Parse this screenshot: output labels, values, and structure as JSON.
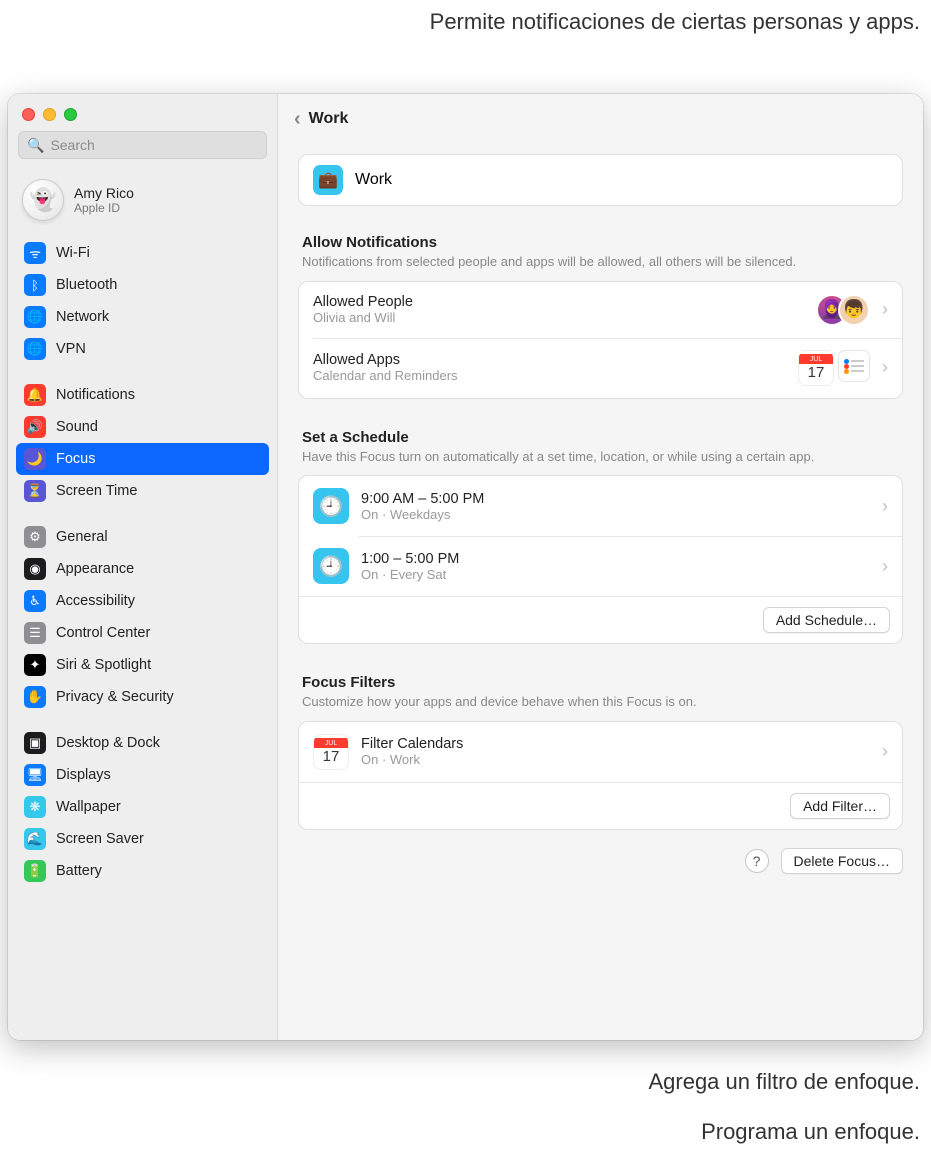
{
  "callouts": {
    "top": "Permite notificaciones de ciertas personas y apps.",
    "filter": "Agrega un filtro de enfoque.",
    "schedule": "Programa un enfoque."
  },
  "search": {
    "placeholder": "Search"
  },
  "user": {
    "name": "Amy Rico",
    "sub": "Apple ID",
    "emoji": "👻"
  },
  "sidebar": [
    {
      "label": "Wi-Fi",
      "color": "#0a7aff",
      "glyph": "ᯤ"
    },
    {
      "label": "Bluetooth",
      "color": "#0a7aff",
      "glyph": "ᛒ"
    },
    {
      "label": "Network",
      "color": "#0a7aff",
      "glyph": "🌐"
    },
    {
      "label": "VPN",
      "color": "#0a7aff",
      "glyph": "🌐"
    },
    {
      "label": "Notifications",
      "color": "#ff3b30",
      "glyph": "🔔"
    },
    {
      "label": "Sound",
      "color": "#ff3b30",
      "glyph": "🔊"
    },
    {
      "label": "Focus",
      "color": "#5856d6",
      "glyph": "🌙",
      "selected": true
    },
    {
      "label": "Screen Time",
      "color": "#5856d6",
      "glyph": "⏳"
    },
    {
      "label": "General",
      "color": "#8e8e93",
      "glyph": "⚙"
    },
    {
      "label": "Appearance",
      "color": "#1c1c1e",
      "glyph": "◉"
    },
    {
      "label": "Accessibility",
      "color": "#0a7aff",
      "glyph": "♿︎"
    },
    {
      "label": "Control Center",
      "color": "#8e8e93",
      "glyph": "☰"
    },
    {
      "label": "Siri & Spotlight",
      "color": "#000",
      "glyph": "✦"
    },
    {
      "label": "Privacy & Security",
      "color": "#0a7aff",
      "glyph": "✋"
    },
    {
      "label": "Desktop & Dock",
      "color": "#1c1c1e",
      "glyph": "▣"
    },
    {
      "label": "Displays",
      "color": "#0a7aff",
      "glyph": "🖥"
    },
    {
      "label": "Wallpaper",
      "color": "#34c8eb",
      "glyph": "❋"
    },
    {
      "label": "Screen Saver",
      "color": "#34c8eb",
      "glyph": "🌊"
    },
    {
      "label": "Battery",
      "color": "#34c759",
      "glyph": "🔋"
    }
  ],
  "gaps": [
    4,
    8,
    14
  ],
  "header": {
    "title": "Work"
  },
  "focus": {
    "name": "Work"
  },
  "allow": {
    "title": "Allow Notifications",
    "desc": "Notifications from selected people and apps will be allowed, all others will be silenced.",
    "people": {
      "title": "Allowed People",
      "sub": "Olivia and Will"
    },
    "apps": {
      "title": "Allowed Apps",
      "sub": "Calendar and Reminders"
    }
  },
  "schedule": {
    "title": "Set a Schedule",
    "desc": "Have this Focus turn on automatically at a set time, location, or while using a certain app.",
    "items": [
      {
        "time": "9:00 AM – 5:00 PM",
        "sub": "On · Weekdays"
      },
      {
        "time": "1:00 – 5:00 PM",
        "sub": "On · Every Sat"
      }
    ],
    "add": "Add Schedule…"
  },
  "filters": {
    "title": "Focus Filters",
    "desc": "Customize how your apps and device behave when this Focus is on.",
    "item": {
      "title": "Filter Calendars",
      "sub": "On · Work"
    },
    "add": "Add Filter…"
  },
  "delete": "Delete Focus…",
  "cal": {
    "month": "JUL",
    "day": "17"
  }
}
